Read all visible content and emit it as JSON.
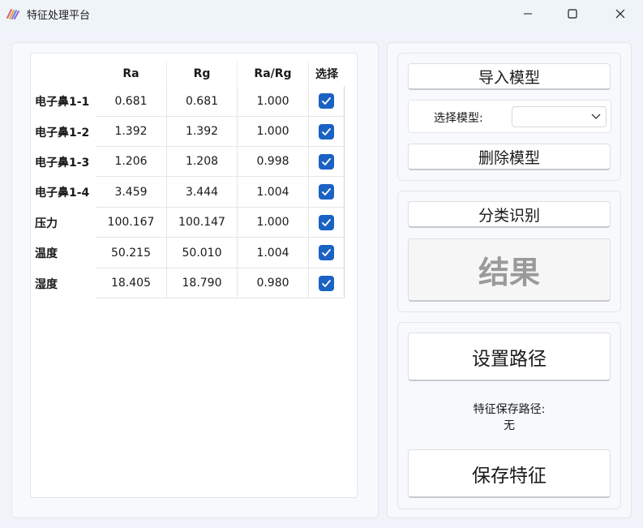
{
  "window": {
    "title": "特征处理平台",
    "controls": {
      "minimize": "minimize-icon",
      "maximize": "maximize-icon",
      "close": "close-icon"
    }
  },
  "table": {
    "columns": [
      "Ra",
      "Rg",
      "Ra/Rg",
      "选择"
    ],
    "rows": [
      {
        "name": "电子鼻1-1",
        "ra": "0.681",
        "rg": "0.681",
        "ratio": "1.000",
        "selected": true
      },
      {
        "name": "电子鼻1-2",
        "ra": "1.392",
        "rg": "1.392",
        "ratio": "1.000",
        "selected": true
      },
      {
        "name": "电子鼻1-3",
        "ra": "1.206",
        "rg": "1.208",
        "ratio": "0.998",
        "selected": true
      },
      {
        "name": "电子鼻1-4",
        "ra": "3.459",
        "rg": "3.444",
        "ratio": "1.004",
        "selected": true
      },
      {
        "name": "压力",
        "ra": "100.167",
        "rg": "100.147",
        "ratio": "1.000",
        "selected": true
      },
      {
        "name": "温度",
        "ra": "50.215",
        "rg": "50.010",
        "ratio": "1.004",
        "selected": true
      },
      {
        "name": "湿度",
        "ra": "18.405",
        "rg": "18.790",
        "ratio": "0.980",
        "selected": true
      }
    ]
  },
  "model": {
    "import_label": "导入模型",
    "select_label": "选择模型:",
    "select_value": "",
    "delete_label": "删除模型"
  },
  "classify": {
    "button_label": "分类识别",
    "result_label": "结果"
  },
  "feature": {
    "set_path_label": "设置路径",
    "path_caption": "特征保存路径:",
    "path_value": "无",
    "save_label": "保存特征"
  },
  "colors": {
    "accent": "#1a62c3",
    "background": "#f0f3f9",
    "result_text": "#9a9a9a"
  }
}
